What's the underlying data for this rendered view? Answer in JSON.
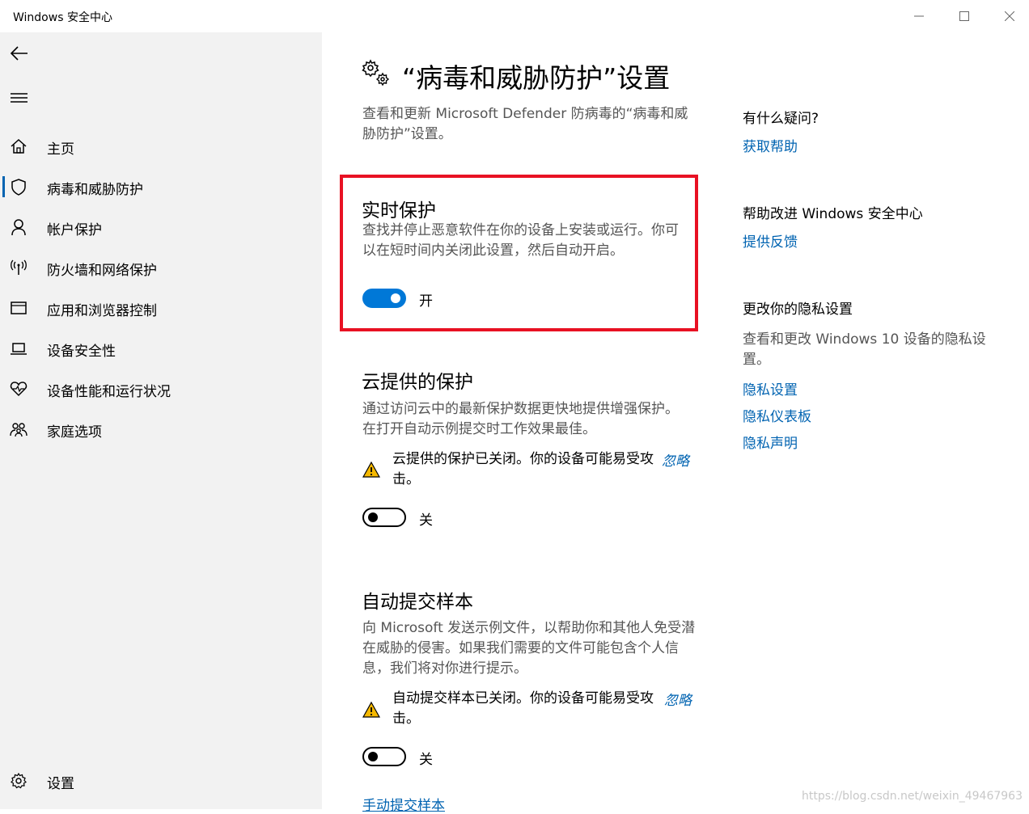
{
  "window": {
    "title": "Windows 安全中心"
  },
  "sidebar": {
    "items": [
      {
        "label": "主页",
        "icon": "home-icon"
      },
      {
        "label": "病毒和威胁防护",
        "icon": "shield-icon",
        "active": true
      },
      {
        "label": "帐户保护",
        "icon": "person-icon"
      },
      {
        "label": "防火墙和网络保护",
        "icon": "antenna-icon"
      },
      {
        "label": "应用和浏览器控制",
        "icon": "browser-window-icon"
      },
      {
        "label": "设备安全性",
        "icon": "laptop-icon"
      },
      {
        "label": "设备性能和运行状况",
        "icon": "heart-pulse-icon"
      },
      {
        "label": "家庭选项",
        "icon": "family-icon"
      }
    ],
    "settings_label": "设置"
  },
  "main": {
    "title": "“病毒和威胁防护”设置",
    "description": "查看和更新 Microsoft Defender 防病毒的“病毒和威胁防护”设置。",
    "realtime": {
      "title": "实时保护",
      "description": "查找并停止恶意软件在你的设备上安装或运行。你可以在短时间内关闭此设置，然后自动开启。",
      "toggle_state": "开",
      "enabled": true
    },
    "cloud": {
      "title": "云提供的保护",
      "description": "通过访问云中的最新保护数据更快地提供增强保护。在打开自动示例提交时工作效果最佳。",
      "warning": "云提供的保护已关闭。你的设备可能易受攻击。",
      "dismiss": "忽略",
      "toggle_state": "关",
      "enabled": false
    },
    "sample": {
      "title": "自动提交样本",
      "description": "向 Microsoft 发送示例文件，以帮助你和其他人免受潜在威胁的侵害。如果我们需要的文件可能包含个人信息，我们将对你进行提示。",
      "warning": "自动提交样本已关闭。你的设备可能易受攻击。",
      "dismiss": "忽略",
      "toggle_state": "关",
      "enabled": false,
      "manual_link": "手动提交样本"
    }
  },
  "right_panel": {
    "question_heading": "有什么疑问?",
    "get_help": "获取帮助",
    "improve_heading": "帮助改进 Windows 安全中心",
    "feedback": "提供反馈",
    "privacy_heading": "更改你的隐私设置",
    "privacy_text": "查看和更改 Windows 10 设备的隐私设置。",
    "privacy_links": [
      "隐私设置",
      "隐私仪表板",
      "隐私声明"
    ]
  },
  "watermark": "https://blog.csdn.net/weixin_49467963",
  "colors": {
    "accent": "#0078d7",
    "link": "#0063b1",
    "highlight": "#e81123",
    "sidebar_bg": "#f2f2f2"
  }
}
